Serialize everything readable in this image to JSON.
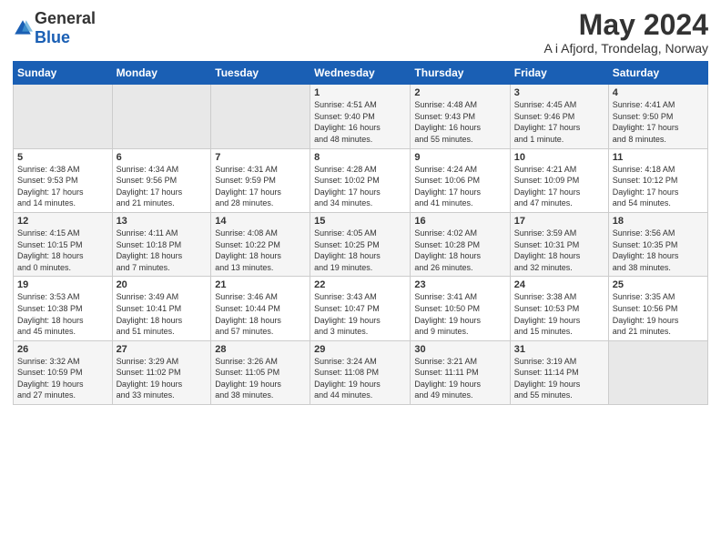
{
  "logo": {
    "general": "General",
    "blue": "Blue"
  },
  "header": {
    "month": "May 2024",
    "location": "A i Afjord, Trondelag, Norway"
  },
  "weekdays": [
    "Sunday",
    "Monday",
    "Tuesday",
    "Wednesday",
    "Thursday",
    "Friday",
    "Saturday"
  ],
  "weeks": [
    [
      {
        "day": "",
        "info": ""
      },
      {
        "day": "",
        "info": ""
      },
      {
        "day": "",
        "info": ""
      },
      {
        "day": "1",
        "info": "Sunrise: 4:51 AM\nSunset: 9:40 PM\nDaylight: 16 hours\nand 48 minutes."
      },
      {
        "day": "2",
        "info": "Sunrise: 4:48 AM\nSunset: 9:43 PM\nDaylight: 16 hours\nand 55 minutes."
      },
      {
        "day": "3",
        "info": "Sunrise: 4:45 AM\nSunset: 9:46 PM\nDaylight: 17 hours\nand 1 minute."
      },
      {
        "day": "4",
        "info": "Sunrise: 4:41 AM\nSunset: 9:50 PM\nDaylight: 17 hours\nand 8 minutes."
      }
    ],
    [
      {
        "day": "5",
        "info": "Sunrise: 4:38 AM\nSunset: 9:53 PM\nDaylight: 17 hours\nand 14 minutes."
      },
      {
        "day": "6",
        "info": "Sunrise: 4:34 AM\nSunset: 9:56 PM\nDaylight: 17 hours\nand 21 minutes."
      },
      {
        "day": "7",
        "info": "Sunrise: 4:31 AM\nSunset: 9:59 PM\nDaylight: 17 hours\nand 28 minutes."
      },
      {
        "day": "8",
        "info": "Sunrise: 4:28 AM\nSunset: 10:02 PM\nDaylight: 17 hours\nand 34 minutes."
      },
      {
        "day": "9",
        "info": "Sunrise: 4:24 AM\nSunset: 10:06 PM\nDaylight: 17 hours\nand 41 minutes."
      },
      {
        "day": "10",
        "info": "Sunrise: 4:21 AM\nSunset: 10:09 PM\nDaylight: 17 hours\nand 47 minutes."
      },
      {
        "day": "11",
        "info": "Sunrise: 4:18 AM\nSunset: 10:12 PM\nDaylight: 17 hours\nand 54 minutes."
      }
    ],
    [
      {
        "day": "12",
        "info": "Sunrise: 4:15 AM\nSunset: 10:15 PM\nDaylight: 18 hours\nand 0 minutes."
      },
      {
        "day": "13",
        "info": "Sunrise: 4:11 AM\nSunset: 10:18 PM\nDaylight: 18 hours\nand 7 minutes."
      },
      {
        "day": "14",
        "info": "Sunrise: 4:08 AM\nSunset: 10:22 PM\nDaylight: 18 hours\nand 13 minutes."
      },
      {
        "day": "15",
        "info": "Sunrise: 4:05 AM\nSunset: 10:25 PM\nDaylight: 18 hours\nand 19 minutes."
      },
      {
        "day": "16",
        "info": "Sunrise: 4:02 AM\nSunset: 10:28 PM\nDaylight: 18 hours\nand 26 minutes."
      },
      {
        "day": "17",
        "info": "Sunrise: 3:59 AM\nSunset: 10:31 PM\nDaylight: 18 hours\nand 32 minutes."
      },
      {
        "day": "18",
        "info": "Sunrise: 3:56 AM\nSunset: 10:35 PM\nDaylight: 18 hours\nand 38 minutes."
      }
    ],
    [
      {
        "day": "19",
        "info": "Sunrise: 3:53 AM\nSunset: 10:38 PM\nDaylight: 18 hours\nand 45 minutes."
      },
      {
        "day": "20",
        "info": "Sunrise: 3:49 AM\nSunset: 10:41 PM\nDaylight: 18 hours\nand 51 minutes."
      },
      {
        "day": "21",
        "info": "Sunrise: 3:46 AM\nSunset: 10:44 PM\nDaylight: 18 hours\nand 57 minutes."
      },
      {
        "day": "22",
        "info": "Sunrise: 3:43 AM\nSunset: 10:47 PM\nDaylight: 19 hours\nand 3 minutes."
      },
      {
        "day": "23",
        "info": "Sunrise: 3:41 AM\nSunset: 10:50 PM\nDaylight: 19 hours\nand 9 minutes."
      },
      {
        "day": "24",
        "info": "Sunrise: 3:38 AM\nSunset: 10:53 PM\nDaylight: 19 hours\nand 15 minutes."
      },
      {
        "day": "25",
        "info": "Sunrise: 3:35 AM\nSunset: 10:56 PM\nDaylight: 19 hours\nand 21 minutes."
      }
    ],
    [
      {
        "day": "26",
        "info": "Sunrise: 3:32 AM\nSunset: 10:59 PM\nDaylight: 19 hours\nand 27 minutes."
      },
      {
        "day": "27",
        "info": "Sunrise: 3:29 AM\nSunset: 11:02 PM\nDaylight: 19 hours\nand 33 minutes."
      },
      {
        "day": "28",
        "info": "Sunrise: 3:26 AM\nSunset: 11:05 PM\nDaylight: 19 hours\nand 38 minutes."
      },
      {
        "day": "29",
        "info": "Sunrise: 3:24 AM\nSunset: 11:08 PM\nDaylight: 19 hours\nand 44 minutes."
      },
      {
        "day": "30",
        "info": "Sunrise: 3:21 AM\nSunset: 11:11 PM\nDaylight: 19 hours\nand 49 minutes."
      },
      {
        "day": "31",
        "info": "Sunrise: 3:19 AM\nSunset: 11:14 PM\nDaylight: 19 hours\nand 55 minutes."
      },
      {
        "day": "",
        "info": ""
      }
    ]
  ]
}
